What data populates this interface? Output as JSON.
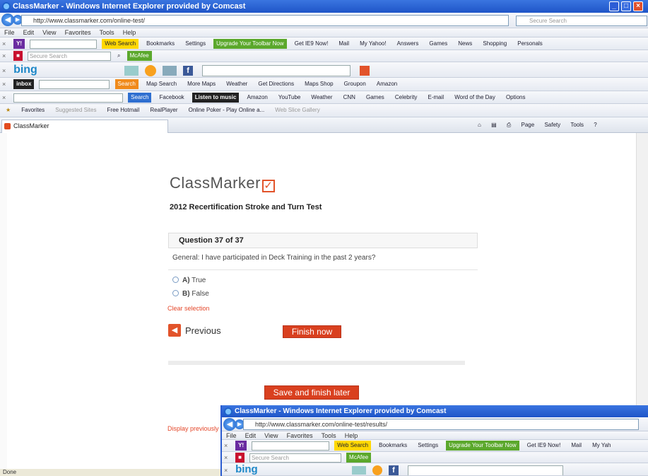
{
  "window": {
    "title": "ClassMarker - Windows Internet Explorer provided by Comcast",
    "url": "http://www.classmarker.com/online-test/",
    "search_placeholder": "Secure Search",
    "menu": [
      "File",
      "Edit",
      "View",
      "Favorites",
      "Tools",
      "Help"
    ]
  },
  "toolbars": {
    "yahoo": [
      "Web Search",
      "Bookmarks",
      "Settings",
      "Upgrade Your Toolbar Now",
      "Get IE9 Now!",
      "Mail",
      "My Yahoo!",
      "Answers",
      "Games",
      "News",
      "Shopping",
      "Personals"
    ],
    "secure_search": "Secure Search",
    "mcafee": "McAfee",
    "bing": "bing",
    "inbox": "inbox",
    "inbox_search": "Search",
    "map_row": [
      "Map Search",
      "More Maps",
      "Weather",
      "Get Directions",
      "Maps Shop",
      "Groupon",
      "Amazon"
    ],
    "search_row_btn": "Search",
    "news_row": [
      "Facebook",
      "Listen to music",
      "Amazon",
      "YouTube",
      "Weather",
      "CNN",
      "Games",
      "Celebrity",
      "E-mail",
      "Word of the Day",
      "Options"
    ],
    "favorites_label": "Favorites",
    "favorites": [
      "Suggested Sites",
      "Free Hotmail",
      "RealPlayer",
      "Online Poker - Play Online a...",
      "Web Slice Gallery"
    ],
    "command_bar": [
      "Page",
      "Safety",
      "Tools"
    ]
  },
  "tab": {
    "label": "ClassMarker"
  },
  "page": {
    "logo_text": "ClassMarker",
    "test_title": "2012 Recertification Stroke and Turn Test",
    "question_header": "Question 37 of 37",
    "question_text": "General: I have participated in Deck Training in the past 2 years?",
    "options": [
      {
        "letter": "A)",
        "label": "True"
      },
      {
        "letter": "B)",
        "label": "False"
      }
    ],
    "clear_selection": "Clear selection",
    "previous_label": "Previous",
    "finish_label": "Finish now",
    "save_label": "Save and finish later",
    "display_link": "Display previously a"
  },
  "status": "Done",
  "window2": {
    "title": "ClassMarker - Windows Internet Explorer provided by Comcast",
    "url": "http://www.classmarker.com/online-test/results/",
    "menu": [
      "File",
      "Edit",
      "View",
      "Favorites",
      "Tools",
      "Help"
    ],
    "toolbar": [
      "Web Search",
      "Bookmarks",
      "Settings",
      "Upgrade Your Toolbar Now",
      "Get IE9 Now!",
      "Mail",
      "My Yah"
    ],
    "secure_search": "Secure Search",
    "mcafee": "McAfee",
    "bing": "bing"
  },
  "colors": {
    "accent": "#e2532a",
    "titlebar": "#1f55c8",
    "button": "#d9401f"
  }
}
